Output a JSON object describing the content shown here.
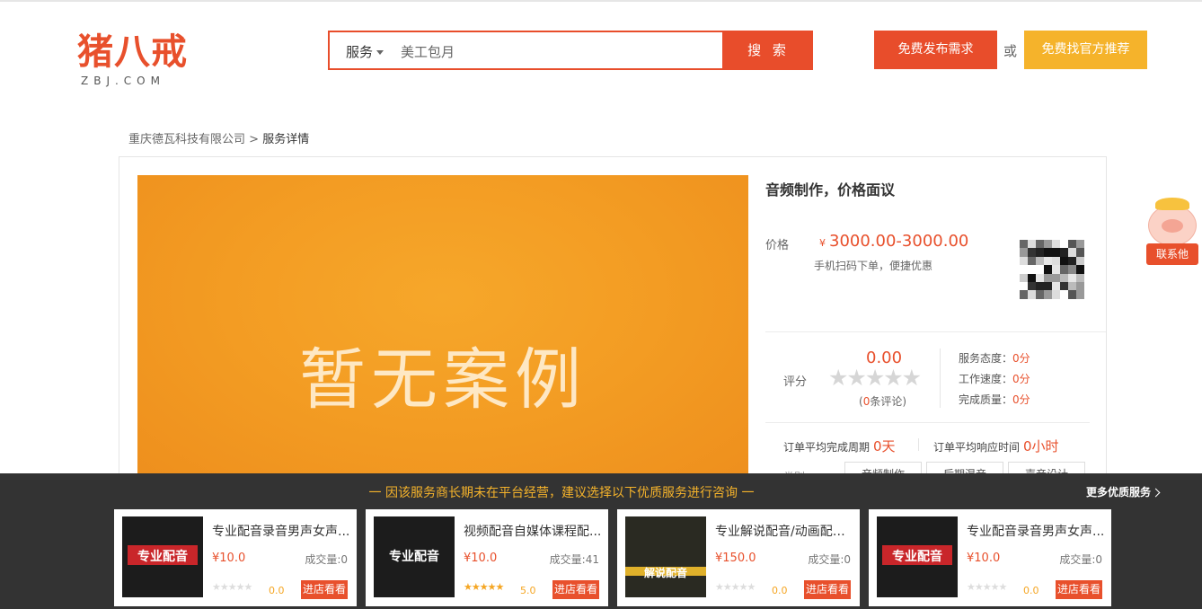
{
  "header": {
    "logo_cn": "猪八戒",
    "logo_en": "ZBJ.COM",
    "search": {
      "type_label": "服务",
      "value": "美工包月",
      "button_label": "搜 索"
    },
    "post_button": "免费发布需求",
    "or_text": "或",
    "recommend_button": "免费找官方推荐"
  },
  "breadcrumb": {
    "parent": "重庆德瓦科技有限公司",
    "separator": " > ",
    "current": "服务详情"
  },
  "service": {
    "banner_text": "暂无案例",
    "title": "音频制作，价格面议",
    "price_label": "价格",
    "price_symbol": "¥",
    "price_value": "3000.00-3000.00",
    "price_hint": "手机扫码下单，便捷优惠",
    "rating": {
      "label": "评分",
      "score": "0.00",
      "stars": "★★★★★",
      "review_prefix": "(",
      "review_count": "0",
      "review_suffix": "条评论)",
      "metrics": [
        {
          "label": "服务态度：",
          "value": "0分"
        },
        {
          "label": "工作速度：",
          "value": "0分"
        },
        {
          "label": "完成质量：",
          "value": "0分"
        }
      ]
    },
    "cycle": {
      "complete_label": "订单平均完成周期",
      "complete_value": "0天",
      "response_label": "订单平均响应时间",
      "response_value": "0小时"
    },
    "category_label": "类别",
    "tags": [
      "音频制作",
      "后期混音",
      "声音设计"
    ]
  },
  "float_contact": {
    "label": "联系他"
  },
  "bottom_bar": {
    "message": "一 因该服务商长期未在平台经营，建议选择以下优质服务进行咨询 一",
    "more_label": "更多优质服务",
    "items": [
      {
        "title": "专业配音录音男声女声...",
        "price": "¥10.0",
        "deals": "成交量:0",
        "rating": "0.0",
        "stars_on": false,
        "button": "进店看看",
        "thumb_text": "专业配音"
      },
      {
        "title": "视频配音自媒体课程配...",
        "price": "¥10.0",
        "deals": "成交量:41",
        "rating": "5.0",
        "stars_on": true,
        "button": "进店看看",
        "thumb_text": "专业配音"
      },
      {
        "title": "专业解说配音/动画配音...",
        "price": "¥150.0",
        "deals": "成交量:0",
        "rating": "0.0",
        "stars_on": false,
        "button": "进店看看",
        "thumb_text": "解说配音"
      },
      {
        "title": "专业配音录音男声女声...",
        "price": "¥10.0",
        "deals": "成交量:0",
        "rating": "0.0",
        "stars_on": false,
        "button": "进店看看",
        "thumb_text": "专业配音"
      }
    ]
  },
  "colors": {
    "brand_red": "#e84d2b",
    "accent_yellow": "#f5b32b",
    "banner_orange": "#f39c23",
    "bottom_bar_bg": "#333333"
  }
}
